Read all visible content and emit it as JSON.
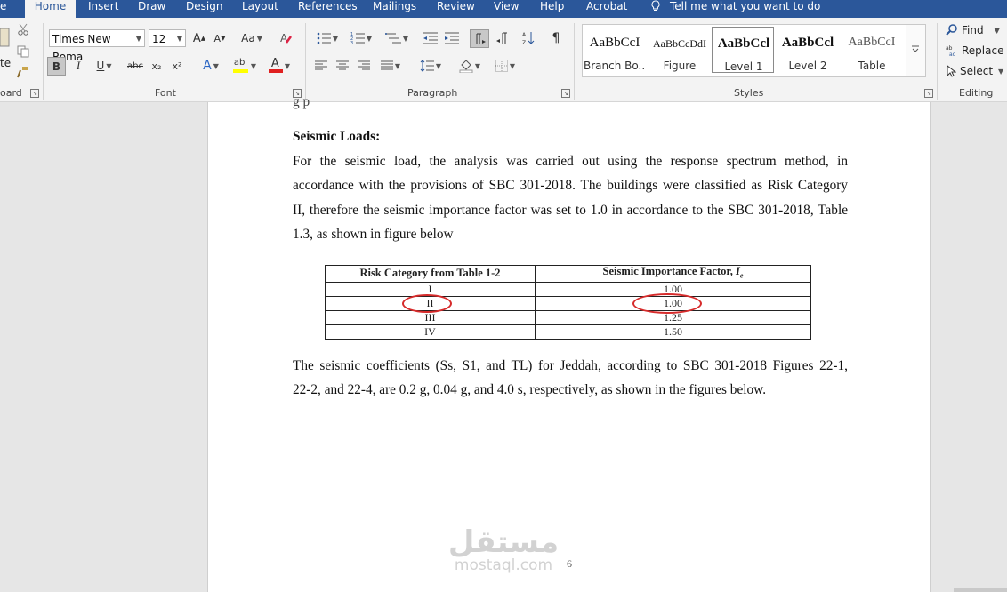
{
  "tabs": {
    "file_partial": "e",
    "home": "Home",
    "insert": "Insert",
    "draw": "Draw",
    "design": "Design",
    "layout": "Layout",
    "references": "References",
    "mailings": "Mailings",
    "review": "Review",
    "view": "View",
    "help": "Help",
    "acrobat": "Acrobat",
    "tell_me": "Tell me what you want to do"
  },
  "ribbon": {
    "clipboard": {
      "paste_partial": "te",
      "label_partial": "oard"
    },
    "font": {
      "label": "Font",
      "font_name": "Times New Roma",
      "font_size": "12",
      "bold": "B",
      "italic": "I",
      "underline": "U",
      "strikethrough": "abc",
      "subscript": "x₂",
      "superscript": "x²",
      "change_case": "Aa",
      "text_effects": "A",
      "highlight_label": "ab",
      "font_color_label": "A",
      "grow_font": "A",
      "shrink_font": "A"
    },
    "paragraph": {
      "label": "Paragraph",
      "pilcrow": "¶"
    },
    "styles": {
      "label": "Styles",
      "items": [
        {
          "sample": "AaBbCcI",
          "name": "Branch Bo..."
        },
        {
          "sample": "AaBbCcDdI",
          "name": "Figure"
        },
        {
          "sample": "AaBbCcl",
          "name": "Level 1"
        },
        {
          "sample": "AaBbCcl",
          "name": "Level 2"
        },
        {
          "sample": "AaBbCcI",
          "name": "Table"
        }
      ]
    },
    "editing": {
      "label": "Editing",
      "find": "Find",
      "replace": "Replace",
      "select": "Select"
    }
  },
  "document": {
    "top_partial": "g                    p",
    "heading": "Seismic Loads:",
    "para1_lines": [
      "For the seismic load, the analysis was carried out using the response spectrum method, in",
      "accordance with the provisions of SBC 301-2018. The buildings were classified as Risk Category",
      "II, therefore the seismic importance factor was set to 1.0 in accordance to the SBC 301-2018, Table",
      "1.3, as shown in figure below"
    ],
    "table": {
      "headers": [
        "Risk Category from Table 1-2",
        "Seismic Importance Factor, "
      ],
      "header_italic": "I",
      "header_sub": "e",
      "rows": [
        [
          "I",
          "1.00"
        ],
        [
          "II",
          "1.00"
        ],
        [
          "III",
          "1.25"
        ],
        [
          "IV",
          "1.50"
        ]
      ]
    },
    "para2_lines": [
      "The seismic coefficients (Ss, S1, and TL) for Jeddah, according to SBC 301-2018 Figures 22-1,",
      "22-2, and 22-4, are 0.2 g, 0.04 g, and 4.0 s, respectively, as shown in the figures below."
    ],
    "watermark_arabic": "مستقل",
    "watermark_latin": "mostaql.com",
    "page_number": "6"
  },
  "colors": {
    "tab_bar": "#2b579a",
    "ribbon_bg": "#f3f3f3",
    "annotation_red": "#d62b2b",
    "highlight_yellow": "#ffff00",
    "font_color_red": "#e02020"
  }
}
